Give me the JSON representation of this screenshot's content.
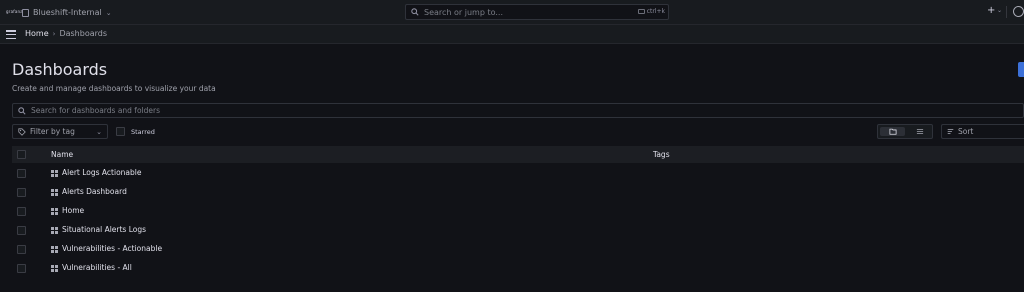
{
  "topbar": {
    "logo_text": "grafana",
    "org_name": "Blueshift-Internal",
    "search_placeholder": "Search or jump to...",
    "search_shortcut": "ctrl+k"
  },
  "breadcrumb": {
    "home": "Home",
    "separator": "›",
    "current": "Dashboards"
  },
  "page": {
    "title": "Dashboards",
    "subtitle": "Create and manage dashboards to visualize your data",
    "search_placeholder": "Search for dashboards and folders",
    "filter_by_tag": "Filter by tag",
    "starred_label": "Starred",
    "sort_label": "Sort",
    "accent_color": "#3d71d9"
  },
  "table": {
    "columns": [
      "Name",
      "Tags"
    ],
    "rows": [
      {
        "name": "Alert Logs Actionable"
      },
      {
        "name": "Alerts Dashboard"
      },
      {
        "name": "Home"
      },
      {
        "name": "Situational Alerts Logs"
      },
      {
        "name": "Vulnerabilities - Actionable"
      },
      {
        "name": "Vulnerabilities - All"
      }
    ]
  }
}
